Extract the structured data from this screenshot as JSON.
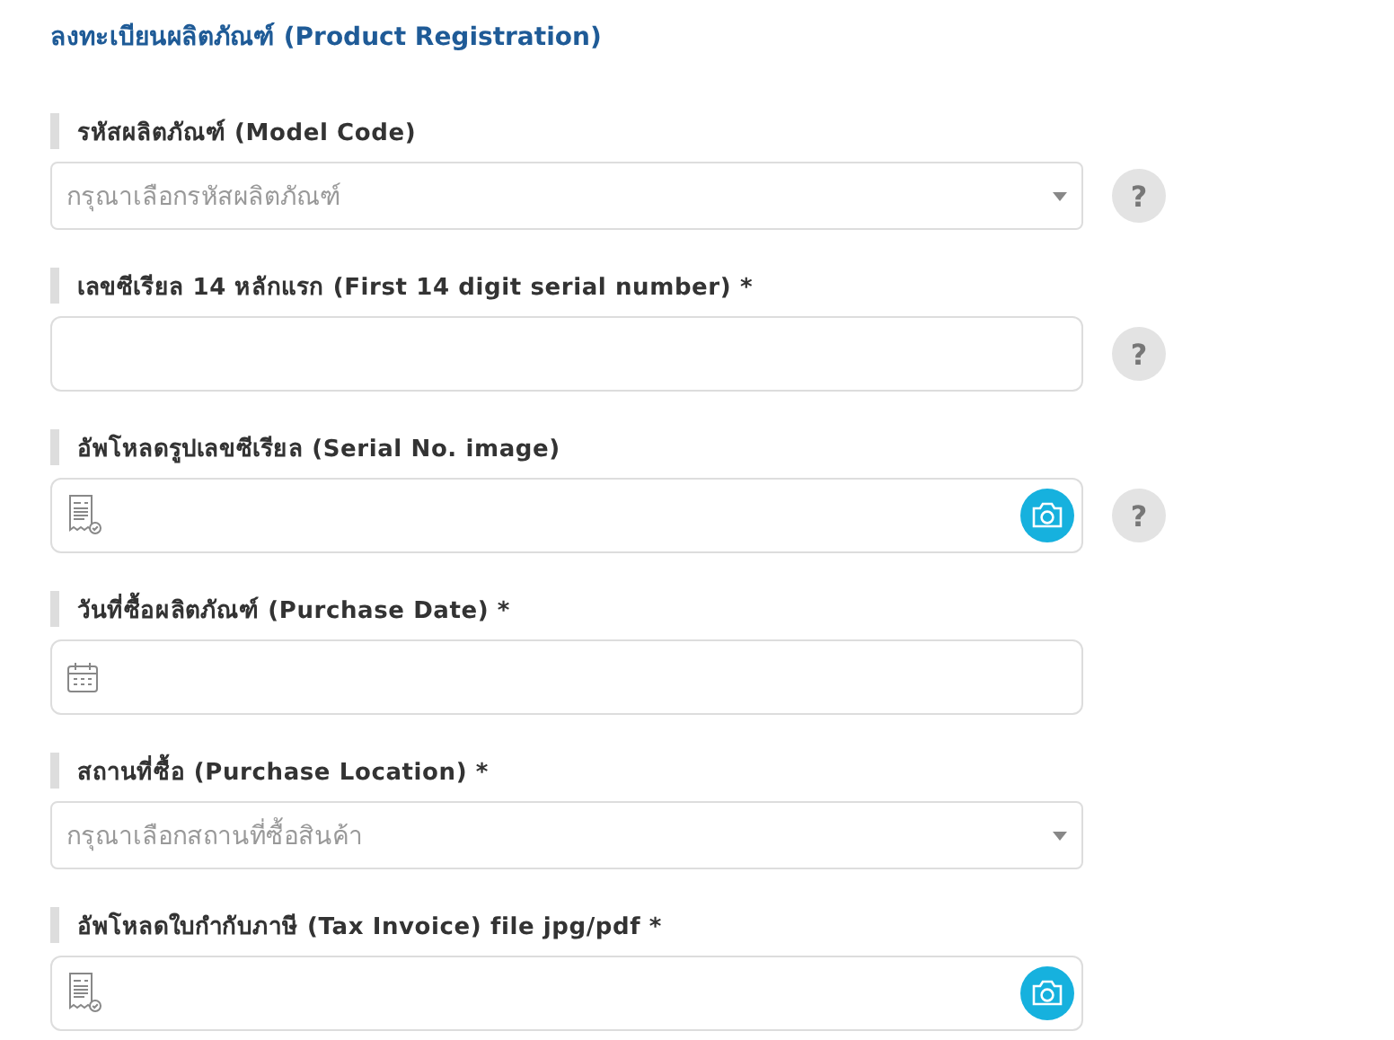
{
  "heading": "ลงทะเบียนผลิตภัณฑ์ (Product Registration)",
  "fields": [
    {
      "kind": "select",
      "label": "รหัสผลิตภัณฑ์ (Model Code)",
      "placeholder": "กรุณาเลือกรหัสผลิตภัณฑ์",
      "help": true,
      "help_text": "?"
    },
    {
      "kind": "text",
      "label": "เลขซีเรียล 14 หลักแรก (First 14 digit serial number) *",
      "help": true,
      "help_text": "?"
    },
    {
      "kind": "file",
      "label": "อัพโหลดรูปเลขซีเรียล (Serial No. image)",
      "help": true,
      "help_text": "?"
    },
    {
      "kind": "date",
      "label": "วันที่ซื้อผลิตภัณฑ์ (Purchase Date) *",
      "help": false
    },
    {
      "kind": "select",
      "label": "สถานที่ซื้อ (Purchase Location) *",
      "placeholder": "กรุณาเลือกสถานที่ซื้อสินค้า",
      "help": false
    },
    {
      "kind": "file",
      "label": "อัพโหลดใบกำกับภาษี (Tax Invoice) file jpg/pdf *",
      "help": false
    }
  ]
}
